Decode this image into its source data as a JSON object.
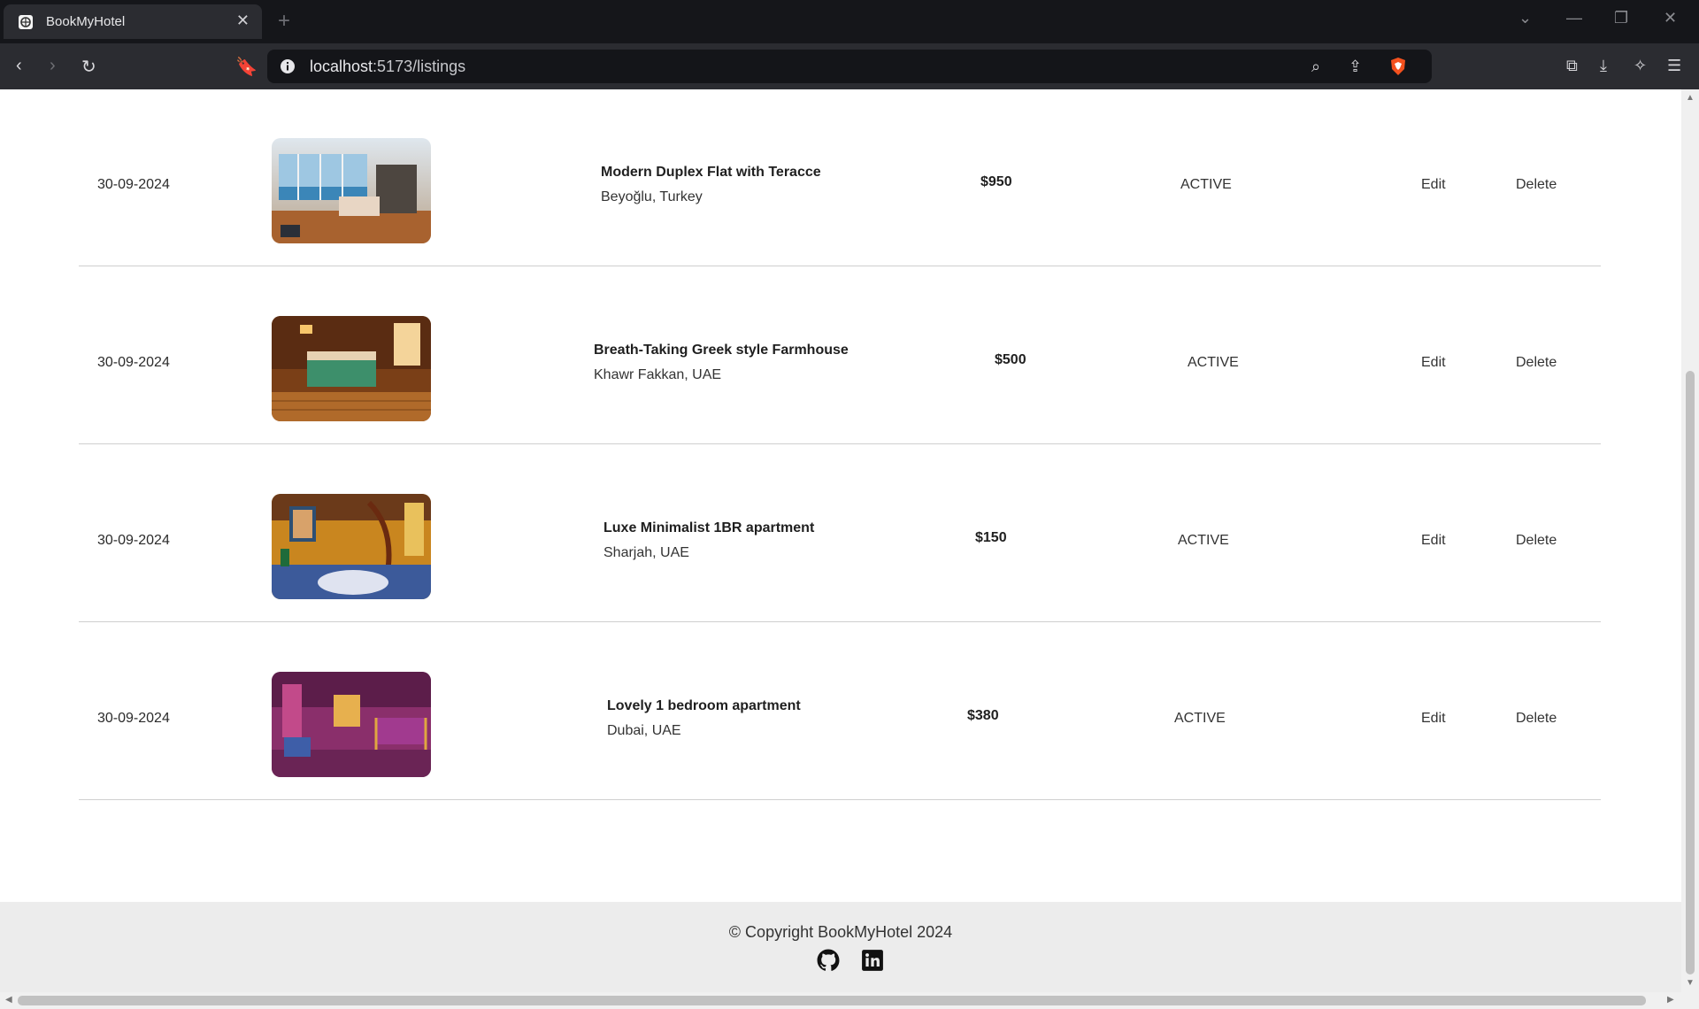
{
  "browser": {
    "tab_title": "BookMyHotel",
    "url_host": "localhost",
    "url_path": ":5173/listings"
  },
  "listings": [
    {
      "date": "30-09-2024",
      "name": "Modern Duplex Flat with Teracce",
      "location": "Beyoğlu, Turkey",
      "price": "$950",
      "status": "ACTIVE",
      "edit": "Edit",
      "delete": "Delete"
    },
    {
      "date": "30-09-2024",
      "name": "Breath-Taking Greek style Farmhouse",
      "location": "Khawr Fakkan, UAE",
      "price": "$500",
      "status": "ACTIVE",
      "edit": "Edit",
      "delete": "Delete"
    },
    {
      "date": "30-09-2024",
      "name": "Luxe Minimalist 1BR apartment",
      "location": "Sharjah, UAE",
      "price": "$150",
      "status": "ACTIVE",
      "edit": "Edit",
      "delete": "Delete"
    },
    {
      "date": "30-09-2024",
      "name": "Lovely 1 bedroom apartment",
      "location": "Dubai, UAE",
      "price": "$380",
      "status": "ACTIVE",
      "edit": "Edit",
      "delete": "Delete"
    }
  ],
  "footer": {
    "copyright": "© Copyright BookMyHotel 2024",
    "icons": [
      "github-icon",
      "linkedin-icon"
    ]
  }
}
